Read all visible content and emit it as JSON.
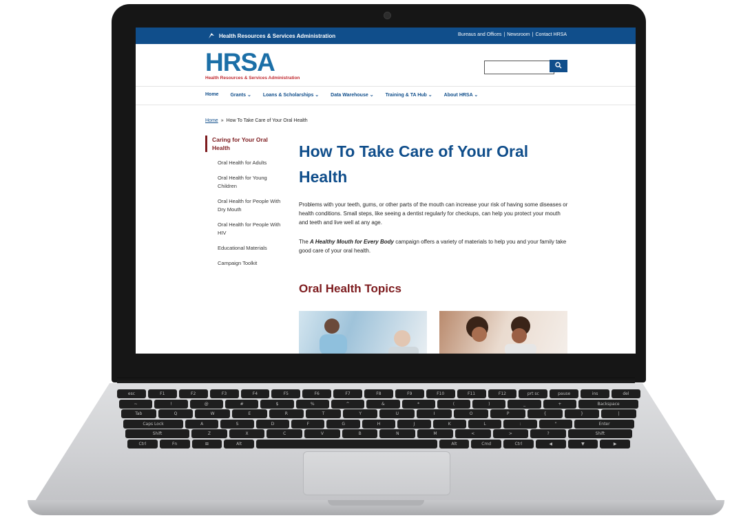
{
  "topbar": {
    "agency_name": "Health Resources & Services Administration",
    "links": [
      "Bureaus and Offices",
      "|",
      "Newsroom",
      "|",
      "Contact HRSA"
    ]
  },
  "logo": {
    "mark": "HRSA",
    "subtitle": "Health Resources & Services Administration"
  },
  "search": {
    "placeholder": "",
    "button_icon": "search-icon"
  },
  "nav": {
    "items": [
      "Home",
      "Grants ⌄",
      "Loans & Scholarships ⌄",
      "Data Warehouse ⌄",
      "Training & TA Hub ⌄",
      "About HRSA ⌄"
    ]
  },
  "breadcrumb": {
    "home": "Home",
    "separator": "»",
    "current": "How To Take Care of Your Oral Health"
  },
  "sidebar": {
    "active": "Caring for Your Oral Health",
    "items": [
      "Oral Health for Adults",
      "Oral Health for Young Children",
      "Oral Health for People With Dry Mouth",
      "Oral Health for People With HIV",
      "Educational Materials",
      "Campaign Toolkit"
    ]
  },
  "main": {
    "title": "How To Take Care of Your Oral Health",
    "intro": "Problems with your teeth, gums, or other parts of the mouth can increase your risk of having some diseases or health conditions. Small steps, like seeing a dentist regularly for checkups, can help you protect your mouth and teeth and live well at any age.",
    "campaign_prefix": "The",
    "campaign_name": "A Healthy Mouth for Every Body",
    "campaign_suffix": "campaign offers a variety of materials to help you and your family take good care of your oral health.",
    "topics_heading": "Oral Health Topics"
  },
  "keyboard": {
    "rows": [
      [
        "esc",
        "F1",
        "F2",
        "F3",
        "F4",
        "F5",
        "F6",
        "F7",
        "F8",
        "F9",
        "F10",
        "F11",
        "F12",
        "prt sc",
        "pause",
        "ins",
        "del"
      ],
      [
        "~",
        "!",
        "@",
        "#",
        "$",
        "%",
        "^",
        "&",
        "*",
        "(",
        ")",
        "_",
        "+",
        "Backspace"
      ],
      [
        "Tab",
        "Q",
        "W",
        "E",
        "R",
        "T",
        "Y",
        "U",
        "I",
        "O",
        "P",
        "{",
        "}",
        "|"
      ],
      [
        "Caps Lock",
        "A",
        "S",
        "D",
        "F",
        "G",
        "H",
        "J",
        "K",
        "L",
        ":",
        "\"",
        "Enter"
      ],
      [
        "Shift",
        "Z",
        "X",
        "C",
        "V",
        "B",
        "N",
        "M",
        "<",
        ">",
        "?",
        "Shift"
      ],
      [
        "Ctrl",
        "Fn",
        "⊞",
        "Alt",
        "",
        "Alt",
        "Cmd",
        "Ctrl",
        "◀",
        "▼",
        "▶"
      ]
    ]
  },
  "colors": {
    "brand_blue": "#104e8b",
    "heading_red": "#7d1b1e",
    "logo_red": "#c0272d"
  }
}
